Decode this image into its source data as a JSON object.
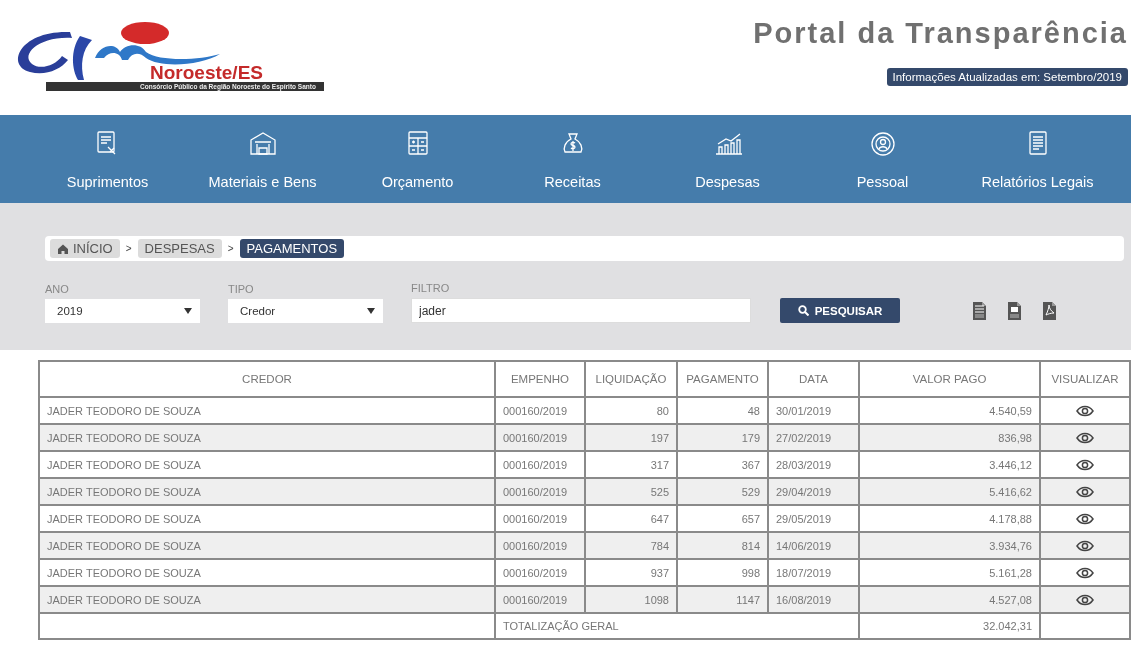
{
  "header": {
    "logo": {
      "name": "Noroeste/ES",
      "tagline": "Consórcio Público da Região Noroeste do Espírito Santo"
    },
    "title": "Portal da Transparência",
    "updated": "Informações Atualizadas em: Setembro/2019"
  },
  "nav": [
    {
      "label": "Suprimentos",
      "kind": "document"
    },
    {
      "label": "Materiais e Bens",
      "kind": "warehouse"
    },
    {
      "label": "Orçamento",
      "kind": "calculator"
    },
    {
      "label": "Receitas",
      "kind": "moneybag"
    },
    {
      "label": "Despesas",
      "kind": "chart"
    },
    {
      "label": "Pessoal",
      "kind": "person"
    },
    {
      "label": "Relatórios Legais",
      "kind": "report"
    }
  ],
  "breadcrumb": {
    "separator": ">",
    "items": [
      {
        "label": "INÍCIO",
        "home": true,
        "selected": false
      },
      {
        "label": "DESPESAS",
        "home": false,
        "selected": false
      },
      {
        "label": "PAGAMENTOS",
        "home": false,
        "selected": true
      }
    ]
  },
  "filters": [
    {
      "kind": "select",
      "label": "ANO",
      "value": "2019"
    },
    {
      "kind": "select",
      "label": "TIPO",
      "value": "Credor"
    },
    {
      "kind": "input",
      "label": "FILTRO",
      "value": "jader"
    }
  ],
  "search_button": "PESQUISAR",
  "exports": [
    {
      "kind": "xls"
    },
    {
      "kind": "csv"
    },
    {
      "kind": "pdf"
    }
  ],
  "table": {
    "columns": [
      "CREDOR",
      "EMPENHO",
      "LIQUIDAÇÃO",
      "PAGAMENTO",
      "DATA",
      "VALOR PAGO",
      "VISUALIZAR"
    ],
    "rows": [
      [
        "JADER TEODORO DE SOUZA",
        "000160/2019",
        "80",
        "48",
        "30/01/2019",
        "4.540,59"
      ],
      [
        "JADER TEODORO DE SOUZA",
        "000160/2019",
        "197",
        "179",
        "27/02/2019",
        "836,98"
      ],
      [
        "JADER TEODORO DE SOUZA",
        "000160/2019",
        "317",
        "367",
        "28/03/2019",
        "3.446,12"
      ],
      [
        "JADER TEODORO DE SOUZA",
        "000160/2019",
        "525",
        "529",
        "29/04/2019",
        "5.416,62"
      ],
      [
        "JADER TEODORO DE SOUZA",
        "000160/2019",
        "647",
        "657",
        "29/05/2019",
        "4.178,88"
      ],
      [
        "JADER TEODORO DE SOUZA",
        "000160/2019",
        "784",
        "814",
        "14/06/2019",
        "3.934,76"
      ],
      [
        "JADER TEODORO DE SOUZA",
        "000160/2019",
        "937",
        "998",
        "18/07/2019",
        "5.161,28"
      ],
      [
        "JADER TEODORO DE SOUZA",
        "000160/2019",
        "1098",
        "1147",
        "16/08/2019",
        "4.527,08"
      ]
    ],
    "total": {
      "label": "TOTALIZAÇÃO GERAL",
      "value": "32.042,31"
    }
  }
}
